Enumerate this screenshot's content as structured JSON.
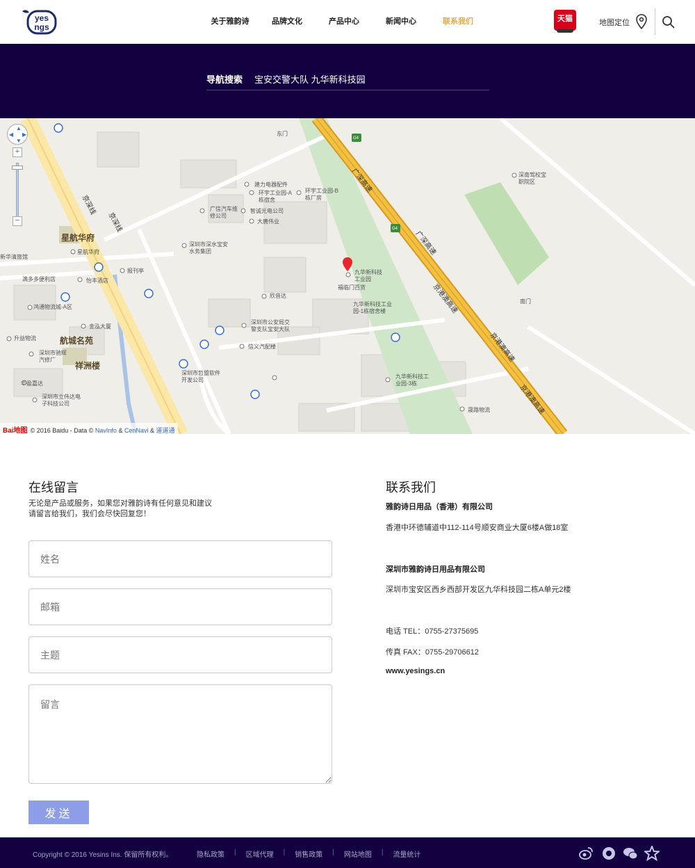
{
  "header": {
    "logo_text": "yesings",
    "nav": [
      {
        "label": "关于雅韵诗"
      },
      {
        "label": "品牌文化"
      },
      {
        "label": "产品中心"
      },
      {
        "label": "新闻中心"
      },
      {
        "label": "联系我们"
      }
    ],
    "active_nav": "联系我们",
    "tmall_label": "天猫",
    "map_location_label": "地图定位"
  },
  "nav_search": {
    "label": "导航搜索",
    "value": "宝安交警大队  九华新科技园"
  },
  "map": {
    "places": [
      {
        "text": "星航华府",
        "big": true
      },
      {
        "text": "航城名苑",
        "big": true
      },
      {
        "text": "祥洲楼",
        "big": true
      },
      {
        "text": "京深线",
        "road": true
      },
      {
        "text": "京深线",
        "road": true
      },
      {
        "text": "广深高速",
        "road": true
      },
      {
        "text": "广深高速",
        "road": true
      },
      {
        "text": "京港澳高速",
        "road": true
      },
      {
        "text": "京港澳高速",
        "road": true
      },
      {
        "text": "京港澳高速",
        "road": true
      },
      {
        "text": "东门"
      },
      {
        "text": "南门"
      },
      {
        "text": "建力电器配件"
      },
      {
        "text": "环宇工业园-A栋宿舍"
      },
      {
        "text": "环宇工业园-B栋厂房"
      },
      {
        "text": "广信汽车维修公司"
      },
      {
        "text": "智诚光电公司"
      },
      {
        "text": "大唐伟业"
      },
      {
        "text": "深圳市深水宝安水务集团"
      },
      {
        "text": "星航华府"
      },
      {
        "text": "新华清旅馆"
      },
      {
        "text": "满多多便利店"
      },
      {
        "text": "怡丰酒店"
      },
      {
        "text": "报刊亭"
      },
      {
        "text": "鸿通物流城-A区"
      },
      {
        "text": "金泓大厦"
      },
      {
        "text": "升益物流"
      },
      {
        "text": "深圳市驰辉汽修厂"
      },
      {
        "text": "华盈嘉达"
      },
      {
        "text": "深圳市立伟达电子科技公司"
      },
      {
        "text": "九华新科技工业园"
      },
      {
        "text": "福临门百货"
      },
      {
        "text": "欣音达"
      },
      {
        "text": "九华新科技工业园-1栋宿舍楼"
      },
      {
        "text": "深圳市公安局交警支队宝安大队"
      },
      {
        "text": "信义汽配楼"
      },
      {
        "text": "深圳市哲盟软件开发公司"
      },
      {
        "text": "九华新科技工业园-3栋"
      },
      {
        "text": "晟路物流"
      },
      {
        "text": "深南驾校宝职院区"
      }
    ],
    "highway_badge": "G4",
    "copyright_prefix": "© 2016 Baidu - Data ©",
    "copyright_link1": "NavInfo",
    "copyright_amp1": "&",
    "copyright_link2": "CenNavi",
    "copyright_amp2": "&",
    "copyright_link3": "道道通",
    "baidu_logo": "Bai地图"
  },
  "message": {
    "title": "在线留言",
    "desc_line1": "无论是产品或服务，如果您对雅韵诗有任何意见和建议",
    "desc_line2": "请留言给我们，我们会尽快回复您！",
    "name_placeholder": "姓名",
    "email_placeholder": "邮箱",
    "subject_placeholder": "主题",
    "message_placeholder": "留言",
    "send_label": "发送"
  },
  "contact": {
    "title": "联系我们",
    "company_hk": "雅韵诗日用品（香港）有限公司",
    "address_hk": "香港中环德辅道中112-114号顺安商业大厦6楼A做18室",
    "company_sz": "深圳市雅韵诗日用品有限公司",
    "address_sz": "深圳市宝安区西乡西部开发区九华科技园二栋A单元2楼",
    "phone": "电话 TEL：0755-27375695",
    "fax": "传真 FAX：0755-29706612",
    "website": "www.yesings.cn"
  },
  "footer": {
    "copyright": "Copyright © 2016 Yesins Ins. 保留所有权利。",
    "links": [
      "隐私政策",
      "区域代理",
      "销售政策",
      "网站地图",
      "流量统计"
    ]
  },
  "colors": {
    "brand_dark": "#120040",
    "nav_active": "#e8a94a",
    "send_button": "#8e9de8",
    "highway": "#f2c043",
    "tmall_red": "#d9001b"
  }
}
